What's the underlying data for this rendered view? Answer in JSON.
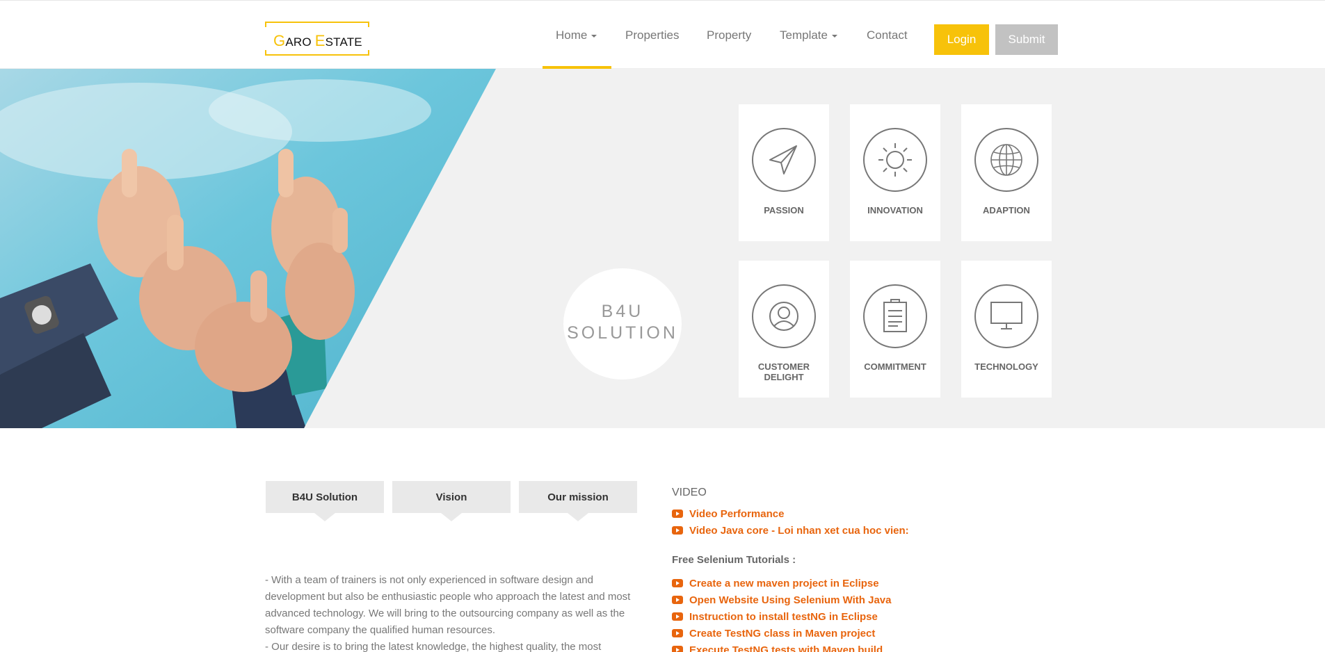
{
  "header": {
    "logo": {
      "g": "G",
      "aro": "ARO",
      "e": "E",
      "state": "STATE"
    },
    "nav": [
      {
        "label": "Home",
        "caret": true
      },
      {
        "label": "Properties",
        "caret": false
      },
      {
        "label": "Property",
        "caret": false
      },
      {
        "label": "Template",
        "caret": true
      },
      {
        "label": "Contact",
        "caret": false
      }
    ],
    "login_label": "Login",
    "submit_label": "Submit",
    "accent": "#f7c20a"
  },
  "hero": {
    "center_title_line1": "B4U",
    "center_title_line2": "SOLUTION",
    "cards": [
      {
        "label": "PASSION",
        "icon": "paper-plane-icon"
      },
      {
        "label": "INNOVATION",
        "icon": "sun-icon"
      },
      {
        "label": "ADAPTION",
        "icon": "globe-icon"
      },
      {
        "label": "CUSTOMER DELIGHT",
        "icon": "user-icon"
      },
      {
        "label": "COMMITMENT",
        "icon": "clipboard-icon"
      },
      {
        "label": "TECHNOLOGY",
        "icon": "monitor-icon"
      }
    ]
  },
  "tabs": [
    {
      "label": "B4U Solution"
    },
    {
      "label": "Vision"
    },
    {
      "label": "Our mission"
    }
  ],
  "about": {
    "paragraph1": "- With a team of trainers is not only experienced in software design and development but also be enthusiastic people who approach the latest and most advanced technology. We will bring to the outsourcing company as well as the software company the qualified human resources.",
    "paragraph2": "- Our desire is to bring the latest knowledge, the highest quality, the most"
  },
  "video": {
    "heading": "VIDEO",
    "links": [
      "Video Performance",
      "Video Java core - Loi nhan xet cua hoc vien:"
    ],
    "free_heading": "Free Selenium Tutorials :",
    "tutorials": [
      "Create a new maven project in Eclipse",
      "Open Website Using Selenium With Java",
      "Instruction to install testNG in Eclipse",
      "Create TestNG class in Maven project",
      "Execute TestNG tests with Maven build"
    ],
    "link_color": "#e8650e"
  }
}
